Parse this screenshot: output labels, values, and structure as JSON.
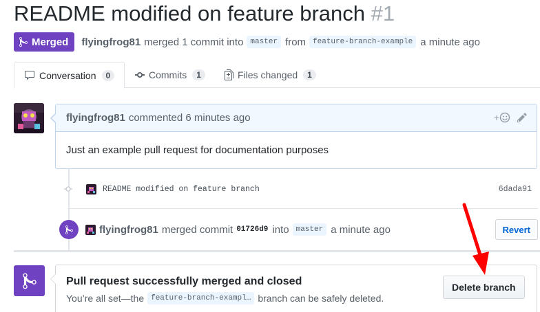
{
  "pr": {
    "title": "README modified on feature branch",
    "number": "#1",
    "state_label": "Merged",
    "author": "flyingfrog81",
    "merged_text": "merged 1 commit into",
    "base_branch": "master",
    "from_text": "from",
    "head_branch": "feature-branch-example",
    "time": "a minute ago"
  },
  "tabs": [
    {
      "label": "Conversation",
      "count": "0",
      "icon": "comment-icon"
    },
    {
      "label": "Commits",
      "count": "1",
      "icon": "commit-icon"
    },
    {
      "label": "Files changed",
      "count": "1",
      "icon": "file-diff-icon"
    }
  ],
  "comment": {
    "author": "flyingfrog81",
    "action": "commented 6 minutes ago",
    "body": "Just an example pull request for documentation purposes",
    "reaction_label": "+"
  },
  "commit": {
    "message": "README modified on feature branch",
    "sha": "6dada91"
  },
  "merge_event": {
    "author": "flyingfrog81",
    "text1": "merged commit",
    "sha": "01726d9",
    "text2": "into",
    "branch": "master",
    "time": "a minute ago",
    "revert_label": "Revert"
  },
  "merge_box": {
    "heading": "Pull request successfully merged and closed",
    "text_before": "You’re all set—the",
    "branch": "feature-branch-exampl…",
    "text_after": "branch can be safely deleted.",
    "delete_label": "Delete branch"
  },
  "colors": {
    "merged_purple": "#6f42c1",
    "annotation_arrow": "#ff0000",
    "link_blue": "#0366d6"
  }
}
